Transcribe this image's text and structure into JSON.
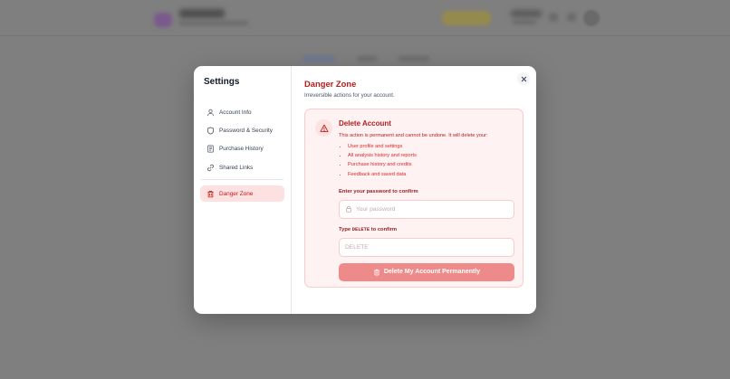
{
  "modal": {
    "title": "Settings",
    "nav": [
      {
        "label": "Account Info",
        "icon": "user-icon"
      },
      {
        "label": "Password & Security",
        "icon": "shield-icon"
      },
      {
        "label": "Purchase History",
        "icon": "receipt-icon"
      },
      {
        "label": "Shared Links",
        "icon": "link-icon"
      }
    ],
    "danger_nav": {
      "label": "Danger Zone",
      "icon": "trash-icon"
    },
    "close_icon": "close-icon"
  },
  "panel": {
    "title": "Danger Zone",
    "subtitle": "Irreversible actions for your account."
  },
  "delete_card": {
    "title": "Delete Account",
    "icon": "warning-icon",
    "description": "This action is permanent and cannot be undone. It will delete your:",
    "items": [
      "User profile and settings",
      "All analysis history and reports",
      "Purchase history and credits",
      "Feedback and saved data"
    ],
    "password_label": "Enter your password to confirm",
    "password_placeholder": "Your password",
    "confirm_label_prefix": "Type ",
    "confirm_label_keyword": "DELETE",
    "confirm_label_suffix": " to confirm",
    "confirm_placeholder": "DELETE",
    "button_label": "Delete My Account Permanently"
  },
  "colors": {
    "danger": "#b91c1c",
    "danger_bg": "#fef2f2",
    "button": "#ef8a8a"
  }
}
